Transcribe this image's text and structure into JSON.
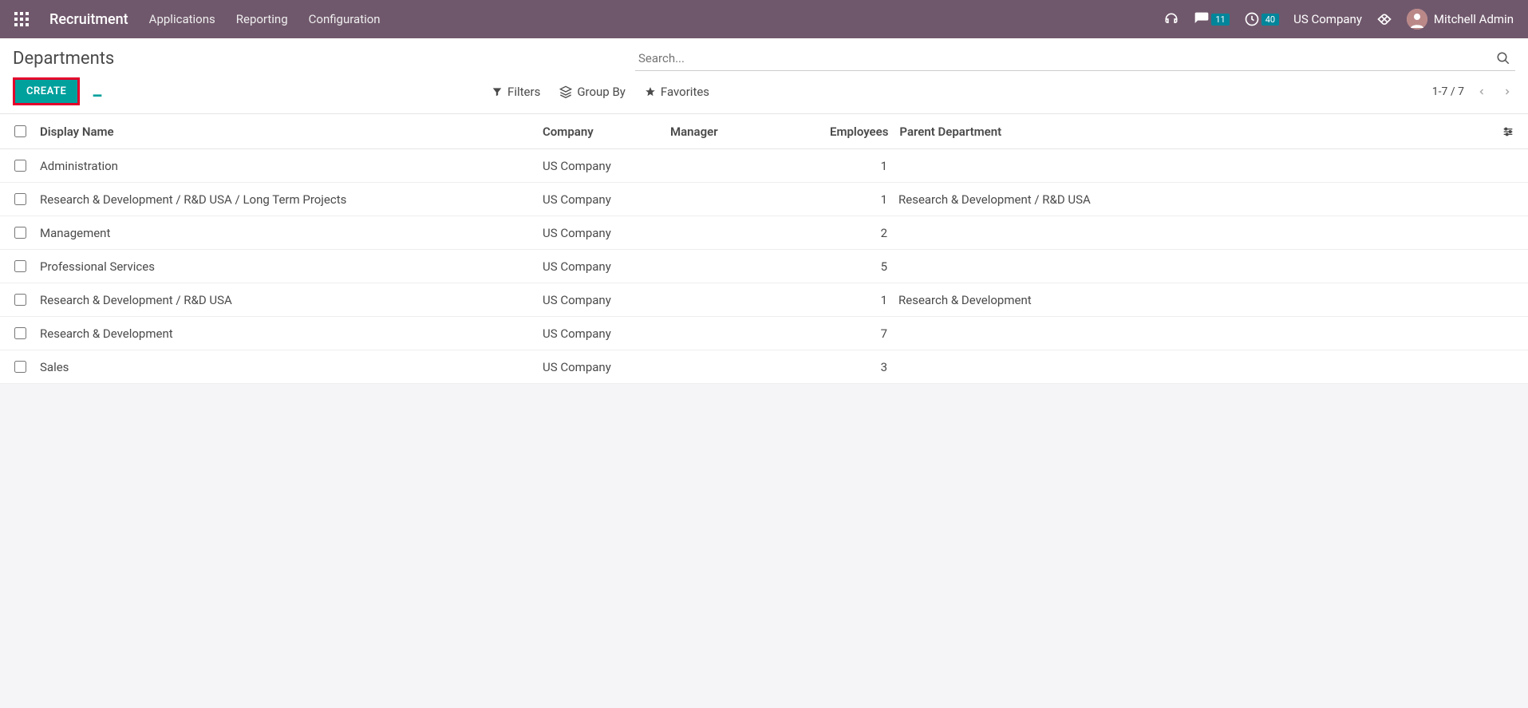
{
  "topbar": {
    "brand": "Recruitment",
    "menu": [
      "Applications",
      "Reporting",
      "Configuration"
    ],
    "discuss_badge": "11",
    "activities_badge": "40",
    "company": "US Company",
    "user": "Mitchell Admin"
  },
  "controls": {
    "page_title": "Departments",
    "create_label": "CREATE",
    "search_placeholder": "Search...",
    "filters_label": "Filters",
    "groupby_label": "Group By",
    "favorites_label": "Favorites",
    "pager": "1-7 / 7"
  },
  "columns": {
    "display_name": "Display Name",
    "company": "Company",
    "manager": "Manager",
    "employees": "Employees",
    "parent_dept": "Parent Department"
  },
  "rows": [
    {
      "name": "Administration",
      "company": "US Company",
      "manager": "",
      "employees": "1",
      "parent": ""
    },
    {
      "name": "Research & Development / R&D USA / Long Term Projects",
      "company": "US Company",
      "manager": "",
      "employees": "1",
      "parent": "Research & Development / R&D USA"
    },
    {
      "name": "Management",
      "company": "US Company",
      "manager": "",
      "employees": "2",
      "parent": ""
    },
    {
      "name": "Professional Services",
      "company": "US Company",
      "manager": "",
      "employees": "5",
      "parent": ""
    },
    {
      "name": "Research & Development / R&D USA",
      "company": "US Company",
      "manager": "",
      "employees": "1",
      "parent": "Research & Development"
    },
    {
      "name": "Research & Development",
      "company": "US Company",
      "manager": "",
      "employees": "7",
      "parent": ""
    },
    {
      "name": "Sales",
      "company": "US Company",
      "manager": "",
      "employees": "3",
      "parent": ""
    }
  ]
}
